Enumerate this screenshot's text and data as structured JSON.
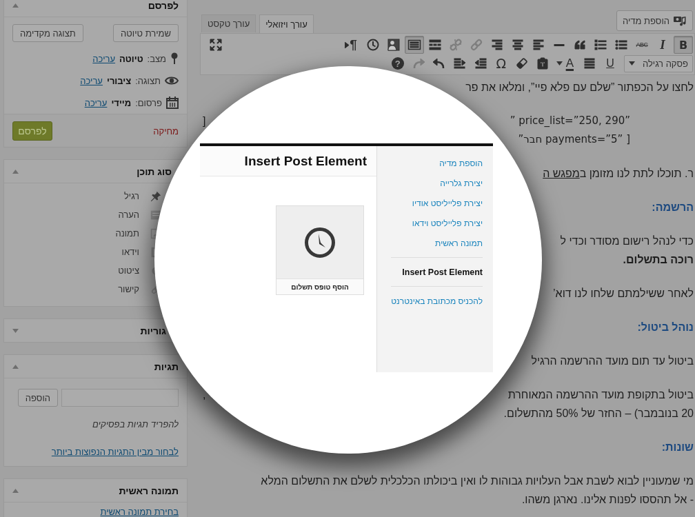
{
  "sidebar": {
    "panels": [
      {
        "kind": "publish",
        "title": "לפרסם",
        "expanded": true,
        "buttons": [
          {
            "label": "שמירת טיוטה"
          },
          {
            "label": "תצוגה מקדימה"
          }
        ],
        "meta": [
          {
            "kind": "status",
            "label": "מצב:",
            "value": "טיוטה",
            "link": "עריכה"
          },
          {
            "kind": "visibility",
            "label": "תצוגה:",
            "value": "ציבורי",
            "link": "עריכה"
          },
          {
            "kind": "schedule",
            "label": "פרסום:",
            "value": "מיידי",
            "link": "עריכה"
          }
        ],
        "delete_link": "מחיקה",
        "publish_button": "לפרסם"
      },
      {
        "kind": "format",
        "title": "סוג תוכן",
        "expanded": true,
        "items": [
          {
            "kind": "standard",
            "label": "רגיל"
          },
          {
            "kind": "aside",
            "label": "הערה"
          },
          {
            "kind": "image",
            "label": "תמונה"
          },
          {
            "kind": "video",
            "label": "וידאו"
          },
          {
            "kind": "quote",
            "label": "ציטוט"
          },
          {
            "kind": "link",
            "label": "קישור"
          }
        ]
      },
      {
        "kind": "categories",
        "title": "גוריות",
        "expanded": false
      },
      {
        "kind": "tags",
        "title": "תגיות",
        "expanded": true,
        "add_button": "הוספה",
        "hint": "להפריד תגיות בפסיקים",
        "link": "לבחור מבין התגיות הנפוצות ביותר"
      },
      {
        "kind": "featured_image",
        "title": "תמונה ראשית",
        "expanded": true,
        "link": "בחירת תמונה ראשית"
      }
    ]
  },
  "editor": {
    "media_button": "הוספת מדיה",
    "tabs": [
      {
        "label": "עורך ויזואלי",
        "selected": true
      },
      {
        "label": "עורך טקסט",
        "selected": false
      }
    ],
    "toolbar": [
      [
        {
          "kind": "bold",
          "label": "B",
          "pressed": true,
          "disabled": false
        },
        {
          "kind": "italic",
          "label": "I",
          "pressed": false,
          "disabled": false
        },
        {
          "kind": "strikethrough",
          "label": "ABC",
          "pressed": false,
          "disabled": false
        },
        {
          "kind": "bullet-list",
          "pressed": false,
          "disabled": false
        },
        {
          "kind": "numbered-list",
          "pressed": false,
          "disabled": false
        },
        {
          "kind": "blockquote",
          "pressed": false,
          "disabled": false
        },
        {
          "kind": "horizontal-line",
          "pressed": false,
          "disabled": false
        },
        {
          "kind": "align-left",
          "pressed": false,
          "disabled": false
        },
        {
          "kind": "align-center",
          "pressed": false,
          "disabled": false
        },
        {
          "kind": "align-right",
          "pressed": false,
          "disabled": false
        },
        {
          "kind": "link",
          "pressed": false,
          "disabled": true
        },
        {
          "kind": "unlink",
          "pressed": false,
          "disabled": true
        },
        {
          "kind": "read-more",
          "pressed": false,
          "disabled": false
        },
        {
          "kind": "toolbar-toggle",
          "pressed": true,
          "disabled": false
        },
        {
          "kind": "profile",
          "pressed": false,
          "disabled": false
        },
        {
          "kind": "clock",
          "pressed": false,
          "disabled": false
        },
        {
          "kind": "rtl",
          "label": "¶",
          "pressed": false,
          "disabled": false
        },
        {
          "kind": "fullscreen",
          "pressed": false,
          "disabled": false
        }
      ],
      [
        {
          "kind": "format-select",
          "label": "פסקה רגילה",
          "pressed": false,
          "disabled": false
        },
        {
          "kind": "underline",
          "label": "U",
          "pressed": false,
          "disabled": false
        },
        {
          "kind": "justify",
          "pressed": false,
          "disabled": false
        },
        {
          "kind": "text-color",
          "label": "A",
          "pressed": false,
          "disabled": false
        },
        {
          "kind": "paste-text",
          "pressed": false,
          "disabled": false
        },
        {
          "kind": "eraser",
          "pressed": false,
          "disabled": false
        },
        {
          "kind": "special-character",
          "label": "Ω",
          "pressed": false,
          "disabled": false
        },
        {
          "kind": "outdent",
          "pressed": false,
          "disabled": false
        },
        {
          "kind": "indent",
          "pressed": false,
          "disabled": false
        },
        {
          "kind": "undo",
          "pressed": false,
          "disabled": false
        },
        {
          "kind": "redo",
          "pressed": false,
          "disabled": true
        },
        {
          "kind": "help",
          "label": "?",
          "pressed": false,
          "disabled": false
        }
      ]
    ],
    "content": [
      {
        "kind": "paragraph",
        "lines": [
          {
            "kind": "plain",
            "text": "לחצו על הכפתור ”שלם עם פלא פיי”, ומלאו את פר"
          }
        ]
      },
      {
        "kind": "paragraph",
        "lines": [
          {
            "kind": "code",
            "text": "” price_list=”250, 290”",
            "left_fragment": "["
          },
          {
            "kind": "code",
            "text": "”חבר payments=”5” ]"
          }
        ]
      },
      {
        "kind": "paragraph",
        "lines": [
          {
            "kind": "plain",
            "text": "ר. תוכלו לתת לנו מזומן ב",
            "link": "מפגש ה"
          }
        ]
      },
      {
        "kind": "heading",
        "lines": [
          {
            "kind": "plain",
            "text": "הרשמה:"
          }
        ]
      },
      {
        "kind": "paragraph",
        "lines": [
          {
            "kind": "plain",
            "text": "כדי לנהל רישום מסודר וכדי ל"
          },
          {
            "kind": "bold",
            "text": "רוכה בתשלום."
          }
        ]
      },
      {
        "kind": "paragraph",
        "lines": [
          {
            "kind": "plain",
            "text": "לאחר ששילמתם שלחו לנו דוא’"
          }
        ]
      },
      {
        "kind": "heading",
        "lines": [
          {
            "kind": "plain",
            "text": "נוהל ביטול:"
          }
        ]
      },
      {
        "kind": "paragraph",
        "lines": [
          {
            "kind": "plain",
            "text": "ביטול עד תום מועד ההרשמה הרגיל"
          }
        ]
      },
      {
        "kind": "paragraph",
        "lines": [
          {
            "kind": "plain",
            "text": "ביטול בתקופת מועד ההרשמה המאוחרת",
            "left_fragment": ","
          },
          {
            "kind": "plain",
            "text": "20 בנובמבר) – החזר של 50% מהתשלום."
          }
        ]
      },
      {
        "kind": "heading",
        "lines": [
          {
            "kind": "plain",
            "text": "שונות:"
          }
        ]
      },
      {
        "kind": "paragraph",
        "lines": [
          {
            "kind": "plain",
            "text": "מי שמעוניין לבוא לשבת אבל העלויות גבוהות לו ואין ביכולתו הכלכלית לשלם את התשלום המלא"
          },
          {
            "kind": "plain",
            "text": "- אל תהססו לפנות אלינו. נארגן משהו."
          }
        ]
      }
    ]
  },
  "magnifier": {
    "modal": {
      "title": "Insert Post Element",
      "card": {
        "caption": "הוסף טופס תשלום"
      },
      "menu_groups": [
        [
          {
            "label": "הוספת מדיה",
            "selected": false
          },
          {
            "label": "יצירת גלרייה",
            "selected": false
          },
          {
            "label": "יצירת פלייליסט אודיו",
            "selected": false
          },
          {
            "label": "יצירת פלייליסט וידאו",
            "selected": false
          },
          {
            "label": "תמונה ראשית",
            "selected": false
          }
        ],
        [
          {
            "label": "Insert Post Element",
            "selected": true
          }
        ],
        [
          {
            "label": "להכניס מכתובת באינטרנט",
            "selected": false
          }
        ]
      ]
    }
  }
}
